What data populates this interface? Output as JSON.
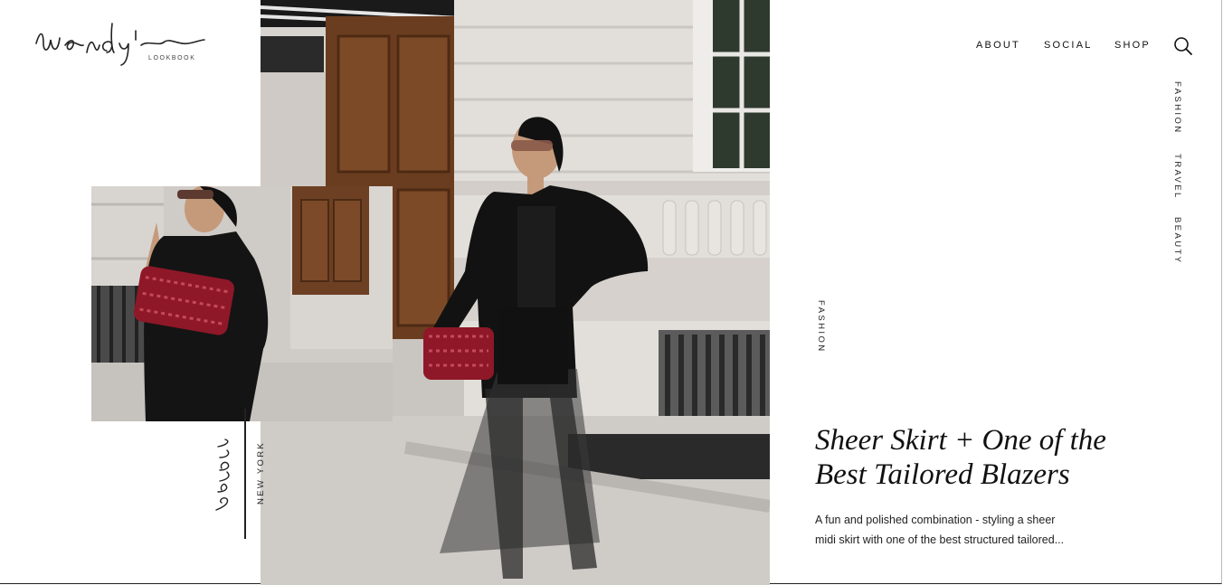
{
  "brand": {
    "logo_script": "Wendy's",
    "logo_sub": "LOOKBOOK"
  },
  "nav": {
    "about": "ABOUT",
    "social": "SOCIAL",
    "shop": "SHOP",
    "search_icon": "search-icon"
  },
  "categories": [
    "FASHION",
    "TRAVEL",
    "BEAUTY"
  ],
  "post": {
    "category": "FASHION",
    "date_script": "2 years ago",
    "location": "NEW YORK",
    "title_line1": "Sheer Skirt + One of the",
    "title_line2": "Best Tailored Blazers",
    "excerpt_line1": "A fun and polished combination - styling a sheer",
    "excerpt_line2": "midi skirt with one of the best structured tailored..."
  },
  "colors": {
    "background": "#ffffff",
    "text": "#111111",
    "bag_red": "#8e1828",
    "stone": "#d9d6d2",
    "door_wood": "#6b3d20"
  }
}
